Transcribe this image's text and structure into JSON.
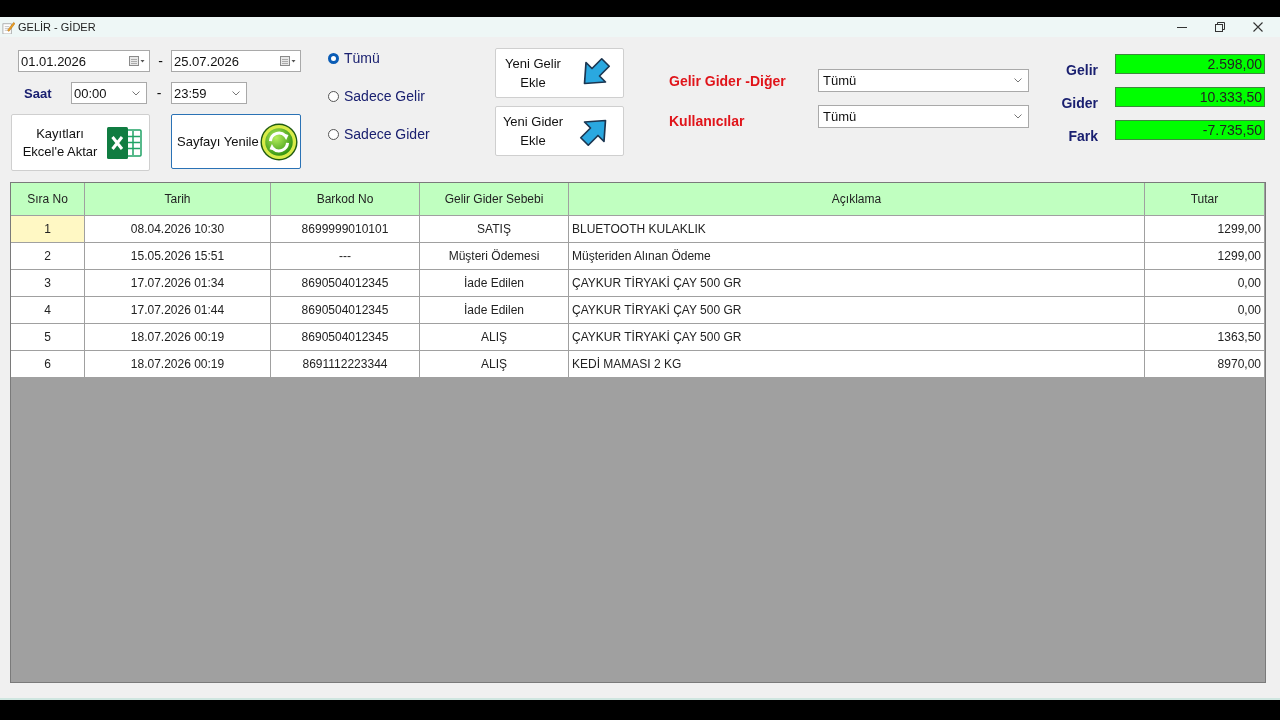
{
  "window": {
    "title": "GELİR - GİDER"
  },
  "date_range": {
    "from": "01.01.2026",
    "separator": "-",
    "to": "25.07.2026"
  },
  "time_range": {
    "label": "Saat",
    "from": "00:00",
    "separator": "-",
    "to": "23:59"
  },
  "left_buttons": [
    {
      "kind": "excel",
      "label": "Kayıtları Ekcel'e Aktar",
      "focused": false
    },
    {
      "kind": "refresh",
      "label": "Sayfayı Yenile",
      "focused": true
    }
  ],
  "radios": [
    {
      "label": "Tümü",
      "selected": true
    },
    {
      "label": "Sadece Gelir",
      "selected": false
    },
    {
      "label": "Sadece Gider",
      "selected": false
    }
  ],
  "add_buttons": [
    {
      "kind": "income",
      "label": "Yeni Gelir Ekle"
    },
    {
      "kind": "expense",
      "label": "Yeni Gider Ekle"
    }
  ],
  "filters": [
    {
      "label": "Gelir Gider -Diğer",
      "value": "Tümü"
    },
    {
      "label": "Kullanıcılar",
      "value": "Tümü"
    }
  ],
  "totals": [
    {
      "label": "Gelir",
      "value": "2.598,00"
    },
    {
      "label": "Gider",
      "value": "10.333,50"
    },
    {
      "label": "Fark",
      "value": "-7.735,50"
    }
  ],
  "table": {
    "columns": [
      "Sıra No",
      "Tarih",
      "Barkod No",
      "Gelir Gider Sebebi",
      "Açıklama",
      "Tutar"
    ],
    "rows": [
      {
        "selected": true,
        "cells": [
          "1",
          "08.04.2026 10:30",
          "8699999010101",
          "SATIŞ",
          "BLUETOOTH KULAKLIK",
          "1299,00"
        ]
      },
      {
        "selected": false,
        "cells": [
          "2",
          "15.05.2026 15:51",
          "---",
          "Müşteri Ödemesi",
          "Müşteriden Alınan Ödeme",
          "1299,00"
        ]
      },
      {
        "selected": false,
        "cells": [
          "3",
          "17.07.2026 01:34",
          "8690504012345",
          "İade Edilen",
          "ÇAYKUR TİRYAKİ ÇAY 500 GR",
          "0,00"
        ]
      },
      {
        "selected": false,
        "cells": [
          "4",
          "17.07.2026 01:44",
          "8690504012345",
          "İade Edilen",
          "ÇAYKUR TİRYAKİ ÇAY 500 GR",
          "0,00"
        ]
      },
      {
        "selected": false,
        "cells": [
          "5",
          "18.07.2026 00:19",
          "8690504012345",
          "ALIŞ",
          "ÇAYKUR TİRYAKİ ÇAY 500 GR",
          "1363,50"
        ]
      },
      {
        "selected": false,
        "cells": [
          "6",
          "18.07.2026 00:19",
          "8691112223344",
          "ALIŞ",
          "KEDİ MAMASI 2 KG",
          "8970,00"
        ]
      }
    ]
  }
}
